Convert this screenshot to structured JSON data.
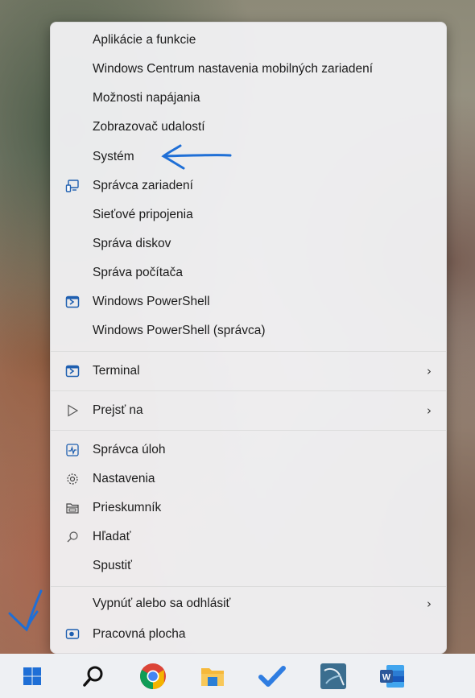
{
  "menu": {
    "items": [
      {
        "label": "Aplikácie a funkcie"
      },
      {
        "label": "Windows Centrum nastavenia mobilných zariadení"
      },
      {
        "label": "Možnosti napájania"
      },
      {
        "label": "Zobrazovač udalostí"
      },
      {
        "label": "Systém"
      },
      {
        "label": "Správca zariadení",
        "icon": "device-manager-icon"
      },
      {
        "label": "Sieťové pripojenia"
      },
      {
        "label": "Správa diskov"
      },
      {
        "label": "Správa počítača"
      },
      {
        "label": "Windows PowerShell",
        "icon": "powershell-icon"
      },
      {
        "label": "Windows PowerShell (správca)"
      },
      {
        "label": "Terminal",
        "icon": "terminal-icon",
        "submenu": true
      },
      {
        "label": "Prejsť na",
        "icon": "play-outline-icon",
        "submenu": true
      },
      {
        "label": "Správca úloh",
        "icon": "task-manager-icon"
      },
      {
        "label": "Nastavenia",
        "icon": "gear-icon"
      },
      {
        "label": "Prieskumník",
        "icon": "folder-icon"
      },
      {
        "label": "Hľadať",
        "icon": "search-icon"
      },
      {
        "label": "Spustiť"
      },
      {
        "label": "Vypnúť alebo sa odhlásiť",
        "submenu": true
      },
      {
        "label": "Pracovná plocha",
        "icon": "desktop-icon"
      }
    ],
    "chevron": "›"
  },
  "taskbar": {
    "icons": [
      "windows-start-icon",
      "search-icon",
      "chrome-icon",
      "file-explorer-icon",
      "todo-check-icon",
      "mysql-workbench-icon",
      "word-icon"
    ]
  },
  "colors": {
    "accent": "#1f6fd6",
    "annotation_arrow": "#1f6fd6",
    "word": "#2b579a"
  }
}
